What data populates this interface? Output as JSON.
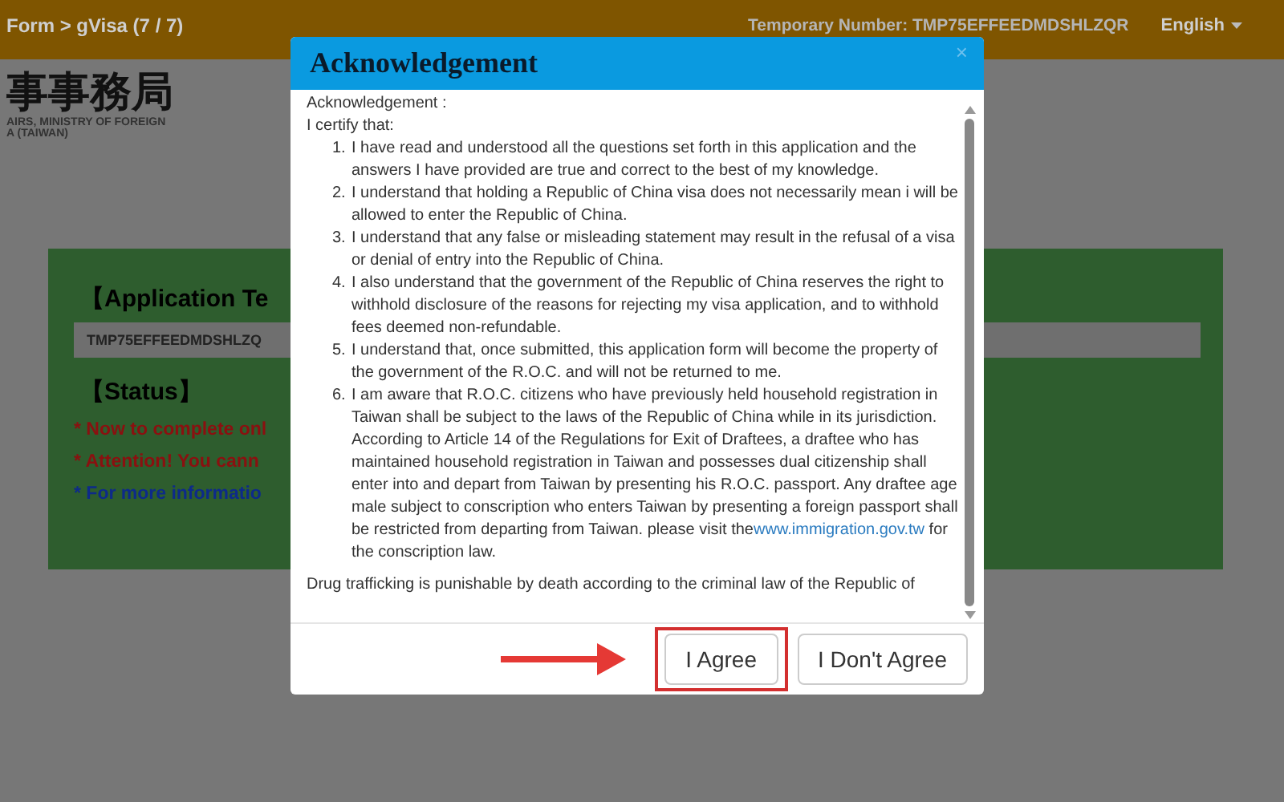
{
  "header": {
    "breadcrumb": "Form > gVisa (7 / 7)",
    "temp_number": "Temporary Number: TMP75EFFEEDMDSHLZQR",
    "language": "English"
  },
  "logo": {
    "title": "事事務局",
    "lines": [
      "AIRS, MINISTRY OF FOREIGN",
      "A (TAIWAN)"
    ]
  },
  "card": {
    "heading": "【Application Te",
    "number_field": "TMP75EFFEEDMDSHLZQ",
    "status_heading": "【Status】",
    "status_lines": [
      {
        "text": "* Now to complete onl",
        "color": "#8b1010"
      },
      {
        "text": "* Attention!  You cann",
        "color": "#8b1010"
      },
      {
        "text": "* For more informatio",
        "color": "#0d2a8a"
      }
    ]
  },
  "modal": {
    "title": "Acknowledgement",
    "close": "×",
    "intro": "Acknowledgement :",
    "certify": "I certify that:",
    "items": [
      {
        "number": "1.",
        "text": "I have read and understood all the questions set forth in this application and the answers I have provided are true and correct to the best of my knowledge."
      },
      {
        "number": "2.",
        "text": "I understand that holding a Republic of China visa does not necessarily mean i will be allowed to enter the Republic of China."
      },
      {
        "number": "3.",
        "text": "I understand that any false or misleading statement may result in the refusal of a visa or denial of entry into the Republic of China."
      },
      {
        "number": "4.",
        "text": "I also understand that the government of the Republic of China reserves the right to withhold disclosure of the reasons for rejecting my visa application, and to withhold fees deemed non-refundable."
      },
      {
        "number": "5.",
        "text": "I understand that, once submitted, this application form will become the property of the government of the R.O.C. and will not be returned to me."
      },
      {
        "number": "6.",
        "text": "I am aware that R.O.C. citizens who have previously held household registration in Taiwan shall be subject to the laws of the Republic of China while in its jurisdiction. According to Article 14 of the Regulations for Exit of Draftees, a draftee who has maintained household registration in Taiwan and possesses dual citizenship shall enter into and depart from Taiwan by presenting his R.O.C. passport. Any draftee age male subject to conscription who enters Taiwan by presenting a foreign passport shall be restricted from departing from Taiwan. please visit the",
        "link": "www.immigration.gov.tw",
        "after": "for the conscription law."
      }
    ],
    "note": "Drug trafficking is punishable by death according to the criminal law of the Republic of",
    "buttons": [
      {
        "label": "I Agree",
        "highlighted": true
      },
      {
        "label": "I Don't Agree",
        "highlighted": false
      }
    ]
  }
}
